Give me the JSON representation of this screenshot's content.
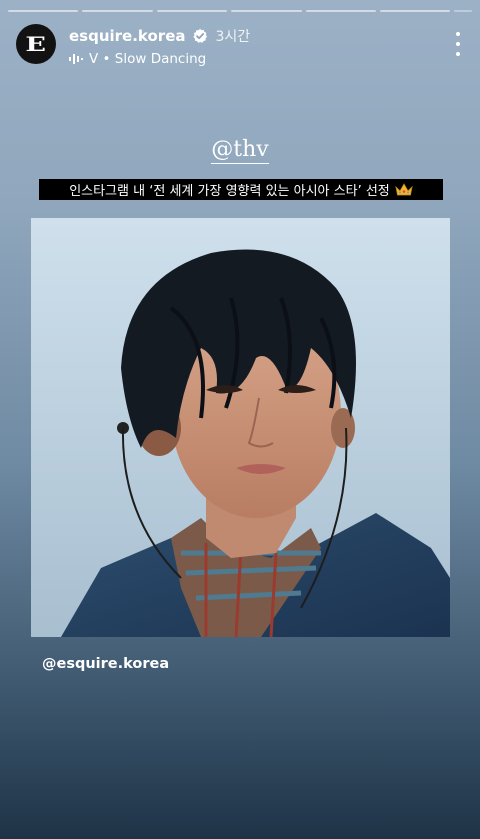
{
  "story": {
    "progress_segments": 7,
    "header": {
      "username": "esquire.korea",
      "time_ago": "3시간",
      "music": "V • Slow Dancing",
      "icons": [
        "esquire-logo",
        "verified-badge-icon",
        "music-bars-icon",
        "more-vertical-icon"
      ]
    },
    "mention": "@thv",
    "caption": "인스타그램 내 ‘전 세계 가장 영향력 있는 아시아 스타’ 선정",
    "caption_emoji": "crown-icon",
    "footer_tag": "@esquire.korea"
  },
  "colors": {
    "background_top": "#9cb1c6",
    "background_bottom": "#1e3346",
    "text": "#ffffff",
    "caption_bg": "#000000",
    "crown": "#f2b632"
  }
}
